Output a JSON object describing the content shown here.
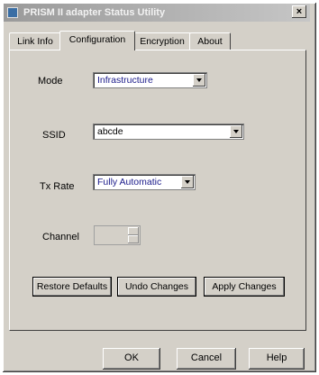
{
  "window": {
    "title": "PRISM II adapter Status Utility",
    "close_label": "×"
  },
  "tabs": [
    {
      "label": "Link Info"
    },
    {
      "label": "Configuration"
    },
    {
      "label": "Encryption"
    },
    {
      "label": "About"
    }
  ],
  "config": {
    "mode_label": "Mode",
    "mode_value": "Infrastructure",
    "ssid_label": "SSID",
    "ssid_value": "abcde",
    "txrate_label": "Tx Rate",
    "txrate_value": "Fully Automatic",
    "channel_label": "Channel",
    "channel_value": ""
  },
  "actions": {
    "restore": "Restore Defaults",
    "undo": "Undo Changes",
    "apply": "Apply Changes"
  },
  "dialog": {
    "ok": "OK",
    "cancel": "Cancel",
    "help": "Help"
  }
}
